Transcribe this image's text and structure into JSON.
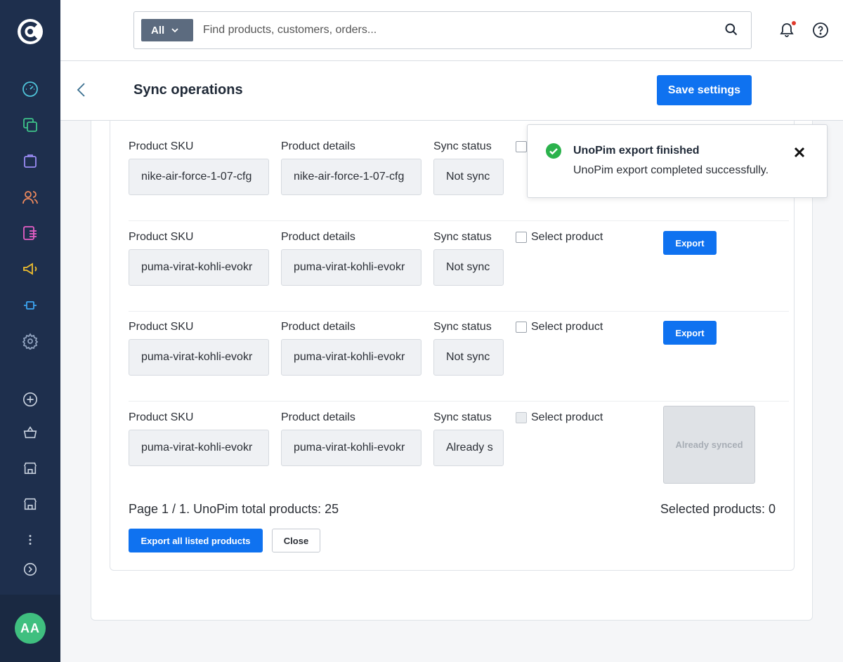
{
  "sidebar": {
    "logo": "shop-logo",
    "avatar_initials": "AA",
    "items": [
      {
        "name": "dashboard-icon",
        "color": "#4fc3d9"
      },
      {
        "name": "products-icon",
        "color": "#3ec48a"
      },
      {
        "name": "orders-icon",
        "color": "#9b8cf5"
      },
      {
        "name": "customers-icon",
        "color": "#f08a5d"
      },
      {
        "name": "content-icon",
        "color": "#e75fc6"
      },
      {
        "name": "marketing-icon",
        "color": "#f2c02e"
      },
      {
        "name": "integrations-icon",
        "color": "#3da6f2"
      },
      {
        "name": "settings-icon",
        "color": "#8fa1bd"
      },
      {
        "name": "add-icon",
        "color": "#c7d0dd"
      },
      {
        "name": "basket-icon",
        "color": "#c7d0dd"
      },
      {
        "name": "store-icon",
        "color": "#c7d0dd"
      },
      {
        "name": "store-icon-2",
        "color": "#c7d0dd"
      },
      {
        "name": "more-icon",
        "color": "#c7d0dd"
      },
      {
        "name": "expand-icon",
        "color": "#c7d0dd"
      }
    ]
  },
  "search": {
    "scope_label": "All",
    "placeholder": "Find products, customers, orders..."
  },
  "page": {
    "title": "Sync operations",
    "save_label": "Save settings"
  },
  "labels": {
    "sku": "Product SKU",
    "details": "Product details",
    "status": "Sync status",
    "select": "Select product",
    "export": "Export",
    "already_synced": "Already synced"
  },
  "products": [
    {
      "sku": "nike-air-force-1-07-cfg",
      "details": "nike-air-force-1-07-cfg",
      "status": "Not sync",
      "action": "export"
    },
    {
      "sku": "puma-virat-kohli-evokr",
      "details": "puma-virat-kohli-evokr",
      "status": "Not sync",
      "action": "export"
    },
    {
      "sku": "puma-virat-kohli-evokr",
      "details": "puma-virat-kohli-evokr",
      "status": "Not sync",
      "action": "export"
    },
    {
      "sku": "puma-virat-kohli-evokr",
      "details": "puma-virat-kohli-evokr",
      "status": "Already s",
      "action": "synced"
    }
  ],
  "footer": {
    "page_info": "Page 1 / 1. UnoPim total products: 25",
    "selected_info": "Selected products: 0",
    "export_all_label": "Export all listed products",
    "close_label": "Close"
  },
  "toast": {
    "title": "UnoPim export finished",
    "message": "UnoPim export completed successfully."
  },
  "colors": {
    "primary": "#0f72f0",
    "sidebar": "#1e2f4d",
    "success": "#2bb24c",
    "notification_dot": "#e0392b"
  }
}
